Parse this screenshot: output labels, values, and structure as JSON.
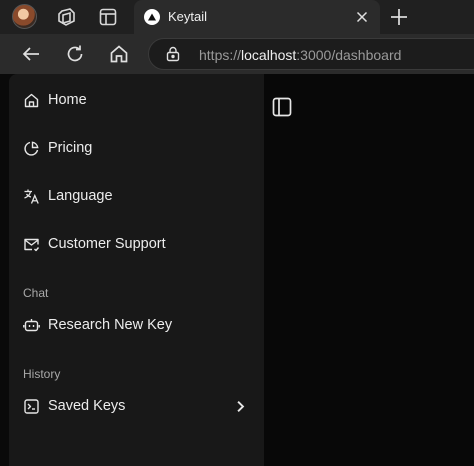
{
  "browser": {
    "tab": {
      "title": "Keytail"
    },
    "address": {
      "scheme": "https://",
      "host": "localhost",
      "rest": ":3000/dashboard"
    }
  },
  "sidebar": {
    "items": [
      {
        "label": "Home",
        "icon": "home-icon"
      },
      {
        "label": "Pricing",
        "icon": "pie-chart-icon"
      },
      {
        "label": "Language",
        "icon": "translate-icon"
      },
      {
        "label": "Customer Support",
        "icon": "mail-icon"
      }
    ],
    "chat": {
      "heading": "Chat",
      "items": [
        {
          "label": "Research New Key",
          "icon": "bot-icon"
        }
      ]
    },
    "history": {
      "heading": "History",
      "items": [
        {
          "label": "Saved Keys",
          "icon": "terminal-icon"
        }
      ]
    }
  }
}
